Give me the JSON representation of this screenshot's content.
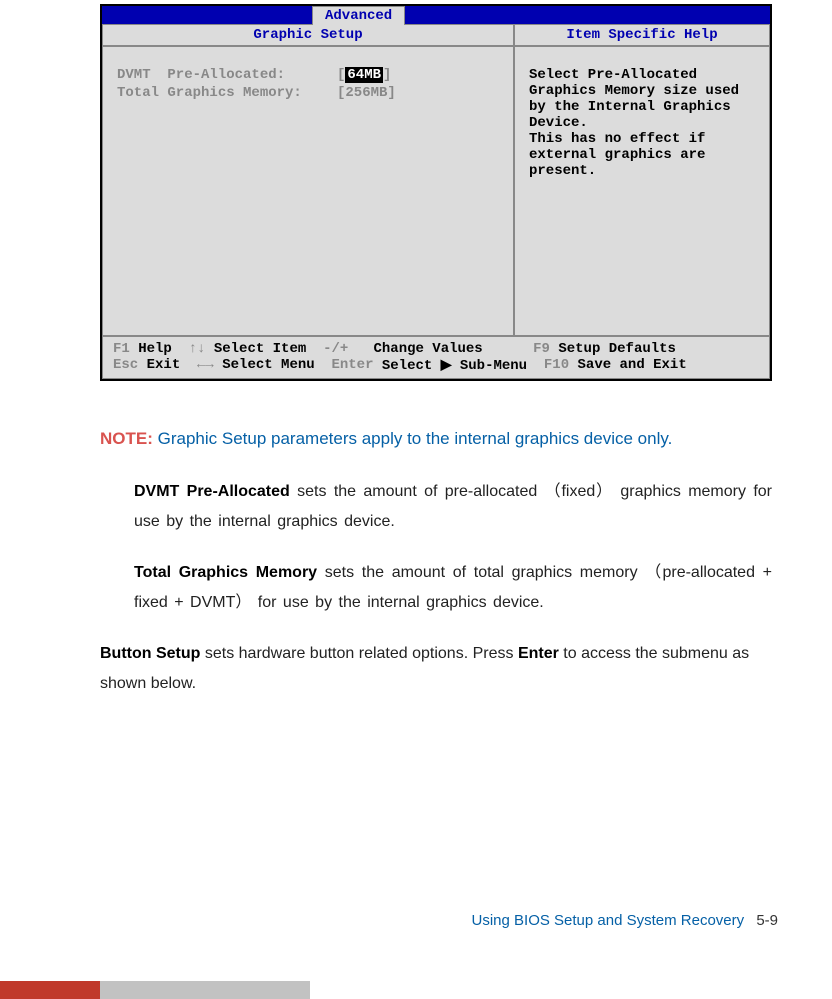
{
  "bios": {
    "tab": "Advanced",
    "header_left": "Graphic Setup",
    "header_right": "Item Specific Help",
    "options": [
      {
        "label": "DVMT  Pre-Allocated:",
        "value": "64MB",
        "selected": true
      },
      {
        "label": "Total Graphics Memory:",
        "value": "256MB",
        "selected": false
      }
    ],
    "help_text": "Select Pre-Allocated Graphics Memory size used by the Internal Graphics Device.\nThis has no effect if external graphics are present.",
    "footer": {
      "line1": {
        "k1": "F1",
        "t1": " Help  ",
        "k2": "↑↓",
        "t2": " Select Item  ",
        "k3": "-/+",
        "t3": "   Change Values      ",
        "k4": "F9",
        "t4": " Setup Defaults"
      },
      "line2": {
        "k1": "Esc",
        "t1": " Exit  ",
        "k2": "←→",
        "t2": " Select Menu  ",
        "k3": "Enter",
        "t3": " Select ▶ Sub-Menu  ",
        "k4": "F10",
        "t4": " Save and Exit"
      }
    }
  },
  "note": {
    "label": "NOTE:",
    "text": " Graphic Setup parameters apply to the internal graphics device only."
  },
  "descriptions": [
    {
      "term": "DVMT Pre-Allocated",
      "body": "  sets the amount of pre-allocated （fixed） graphics memory for  use  by  the  internal  graphics  device."
    },
    {
      "term": "Total Graphics Memory",
      "body": " sets the amount of total graphics memory （pre-allocated +  fixed  +  DVMT）  for  use  by  the  internal  graphics  device."
    }
  ],
  "button_setup": {
    "term": "Button Setup",
    "body_pre": "  sets hardware button related options. Press ",
    "body_key": "Enter",
    "body_post": " to access the submenu as  shown  below."
  },
  "footer": {
    "text": "Using BIOS Setup and System Recovery",
    "page": "5-9"
  }
}
